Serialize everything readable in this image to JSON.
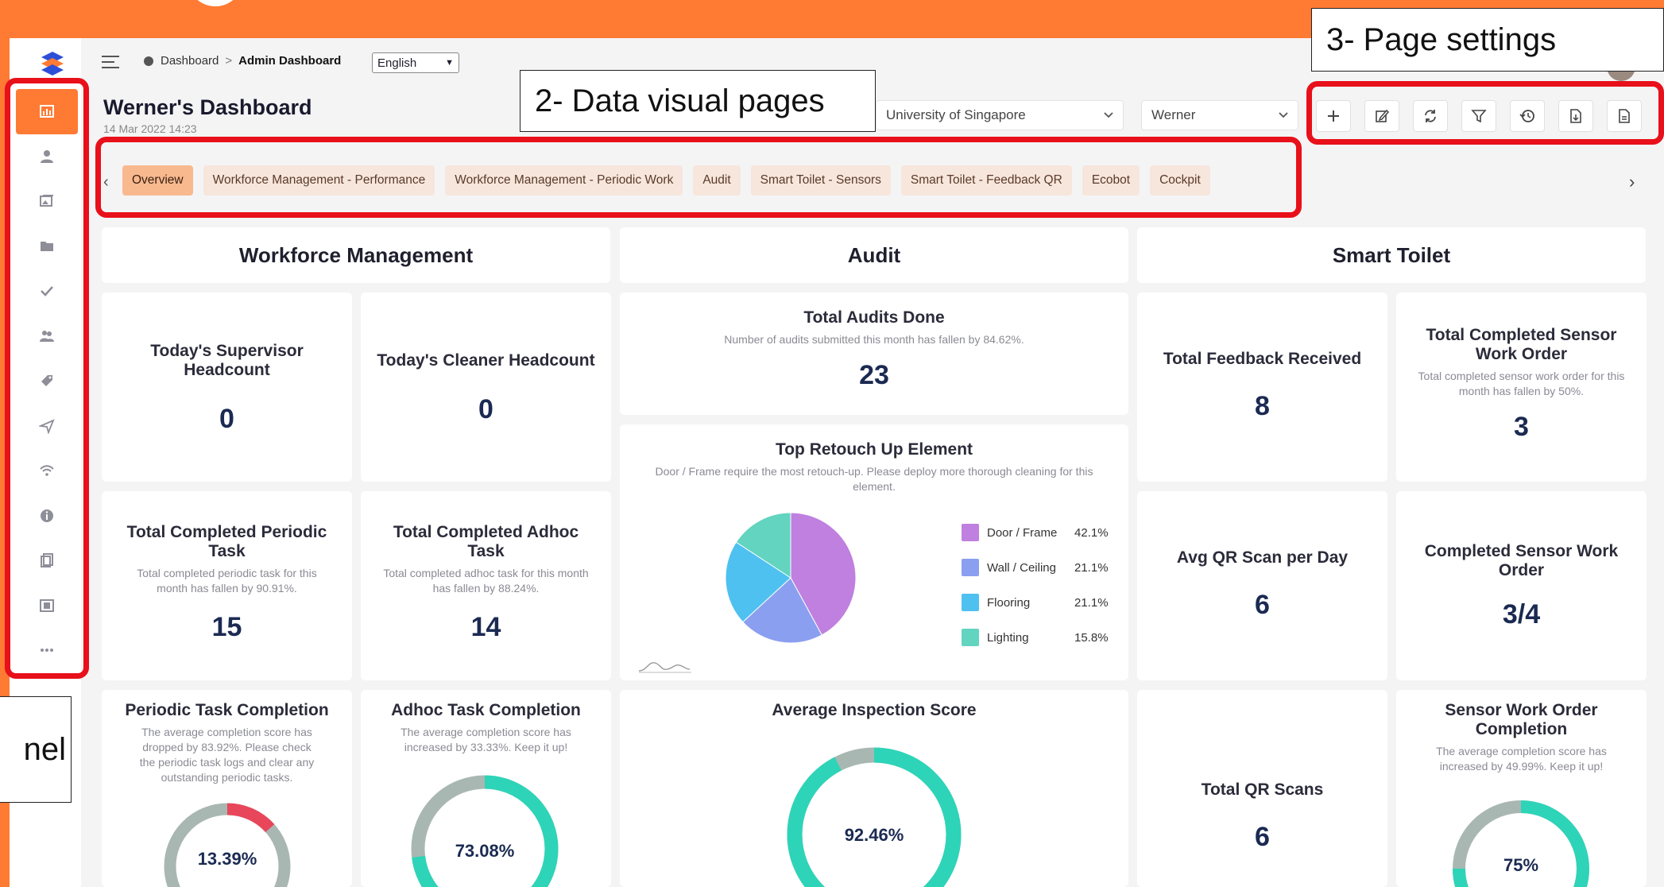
{
  "annotations": {
    "data_visual_pages": "2- Data visual pages",
    "page_settings": "3- Page settings",
    "left_partial": "nel"
  },
  "topbar": {
    "breadcrumb_root": "Dashboard",
    "breadcrumb_separator": ">",
    "breadcrumb_current": "Admin Dashboard",
    "language": "English"
  },
  "header": {
    "title": "Werner's Dashboard",
    "date": "14 Mar 2022 14:23",
    "location_select": "University of Singapore",
    "user_select": "Werner"
  },
  "toolbar_icons": [
    "plus-icon",
    "edit-icon",
    "refresh-icon",
    "filter-icon",
    "history-icon",
    "export-file-icon",
    "document-icon"
  ],
  "sidebar_icons": [
    "chart-icon",
    "user-icon",
    "gallery-icon",
    "folder-icon",
    "check-icon",
    "users-icon",
    "tag-icon",
    "send-icon",
    "wifi-icon",
    "info-icon",
    "copy-icon",
    "media-icon",
    "more-icon"
  ],
  "tabs": [
    "Overview",
    "Workforce Management - Performance",
    "Workforce Management - Periodic Work",
    "Audit",
    "Smart Toilet - Sensors",
    "Smart Toilet - Feedback QR",
    "Ecobot",
    "Cockpit"
  ],
  "sections": {
    "workforce": "Workforce Management",
    "audit": "Audit",
    "toilet": "Smart Toilet"
  },
  "cards": {
    "supervisor": {
      "title": "Today's Supervisor Headcount",
      "value": "0"
    },
    "cleaner": {
      "title": "Today's Cleaner Headcount",
      "value": "0"
    },
    "periodic_task": {
      "title": "Total Completed Periodic Task",
      "desc": "Total completed periodic task for this month has fallen by 90.91%.",
      "value": "15"
    },
    "adhoc_task": {
      "title": "Total Completed Adhoc Task",
      "desc": "Total completed adhoc task for this month has fallen by 88.24%.",
      "value": "14"
    },
    "audits_done": {
      "title": "Total Audits Done",
      "desc": "Number of audits submitted this month has fallen by 84.62%.",
      "value": "23"
    },
    "retouch": {
      "title": "Top Retouch Up Element",
      "desc": "Door / Frame require the most retouch-up. Please deploy more thorough cleaning for this element."
    },
    "feedback": {
      "title": "Total Feedback Received",
      "value": "8"
    },
    "sensor_wo": {
      "title": "Total Completed Sensor Work Order",
      "desc": "Total completed sensor work order for this month has fallen by 50%.",
      "value": "3"
    },
    "avg_qr": {
      "title": "Avg QR Scan per Day",
      "value": "6"
    },
    "completed_sensor": {
      "title": "Completed Sensor Work Order",
      "value": "3/4"
    },
    "periodic_completion": {
      "title": "Periodic Task Completion",
      "desc": "The average completion score has dropped by 83.92%. Please check the periodic task logs and clear any outstanding periodic tasks.",
      "value": "13.39%"
    },
    "adhoc_completion": {
      "title": "Adhoc Task Completion",
      "desc": "The average completion score has increased by 33.33%. Keep it up!",
      "value": "73.08%"
    },
    "inspection": {
      "title": "Average Inspection Score",
      "value": "92.46%"
    },
    "qr_scans": {
      "title": "Total QR Scans",
      "value": "6"
    },
    "sensor_completion": {
      "title": "Sensor Work Order Completion",
      "desc": "The average completion score has increased by 49.99%. Keep it up!",
      "value": "75%"
    }
  },
  "chart_data": [
    {
      "type": "pie",
      "title": "Top Retouch Up Element",
      "categories": [
        "Door / Frame",
        "Wall / Ceiling",
        "Flooring",
        "Lighting"
      ],
      "values": [
        42.1,
        21.1,
        21.1,
        15.8
      ],
      "labels": [
        "42.1%",
        "21.1%",
        "21.1%",
        "15.8%"
      ],
      "colors": [
        "#bf80e0",
        "#8a9ff0",
        "#4fc1f0",
        "#62d4c0"
      ],
      "legend": "right"
    },
    {
      "type": "gauge",
      "title": "Periodic Task Completion",
      "value": 13.39,
      "max": 100,
      "colors": {
        "fill": "#e8465a",
        "track": "#a9b7b2"
      }
    },
    {
      "type": "gauge",
      "title": "Adhoc Task Completion",
      "value": 73.08,
      "max": 100,
      "colors": {
        "fill": "#2ed4b8",
        "track": "#a9b7b2"
      }
    },
    {
      "type": "gauge",
      "title": "Average Inspection Score",
      "value": 92.46,
      "max": 100,
      "colors": {
        "fill": "#2ed4b8",
        "track": "#a9b7b2"
      }
    },
    {
      "type": "gauge",
      "title": "Sensor Work Order Completion",
      "value": 75,
      "max": 100,
      "colors": {
        "fill": "#2ed4b8",
        "track": "#a9b7b2"
      }
    }
  ]
}
